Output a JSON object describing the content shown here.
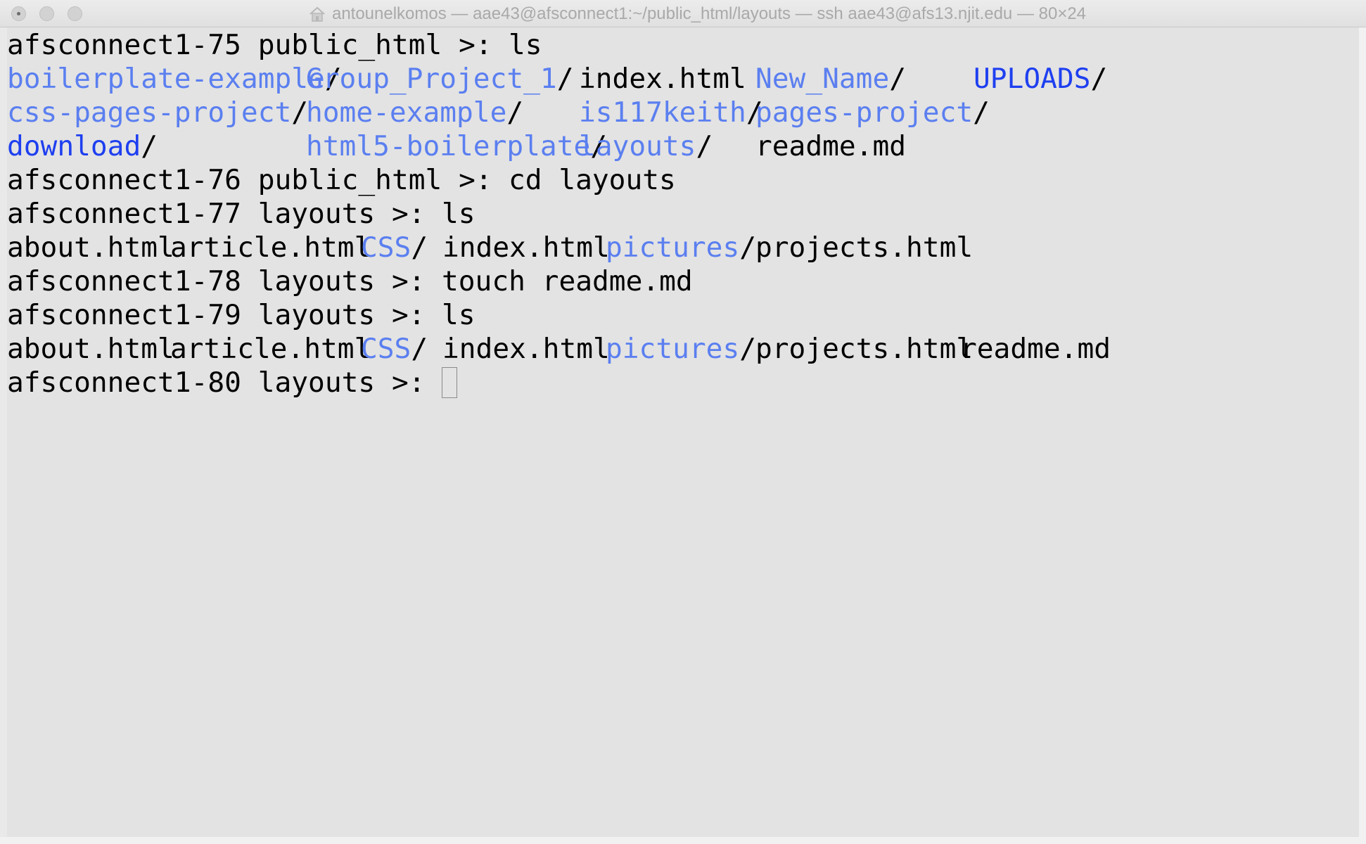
{
  "window": {
    "title": "antounelkomos — aae43@afsconnect1:~/public_html/layouts — ssh aae43@afs13.njit.edu — 80×24",
    "icon": "home-icon",
    "background": "#e3e3e3"
  },
  "colors": {
    "directory": "#5b7ff0",
    "directory_emphasized": "#1e3ff0",
    "text": "#000000"
  },
  "terminal": {
    "lines": [
      {
        "prompt": "afsconnect1-75 public_html >: ",
        "command": "ls"
      },
      {
        "entries": [
          {
            "name": "boilerplate-example",
            "suffix": "/",
            "type": "dir"
          },
          {
            "name": "Group_Project_1",
            "suffix": "/",
            "type": "dir"
          },
          {
            "name": "index.html",
            "suffix": "",
            "type": "file"
          },
          {
            "name": "New_Name",
            "suffix": "/",
            "type": "dir"
          },
          {
            "name": "UPLOADS",
            "suffix": "/",
            "type": "dir-strong"
          }
        ]
      },
      {
        "entries": [
          {
            "name": "css-pages-project",
            "suffix": "/",
            "type": "dir"
          },
          {
            "name": "home-example",
            "suffix": "/",
            "type": "dir"
          },
          {
            "name": "is117keith",
            "suffix": "/",
            "type": "dir"
          },
          {
            "name": "pages-project",
            "suffix": "/",
            "type": "dir"
          }
        ]
      },
      {
        "entries": [
          {
            "name": "download",
            "suffix": "/",
            "type": "dir-strong"
          },
          {
            "name": "html5-boilerplate",
            "suffix": "/",
            "type": "dir"
          },
          {
            "name": "layouts",
            "suffix": "/",
            "type": "dir"
          },
          {
            "name": "readme.md",
            "suffix": "",
            "type": "file"
          }
        ]
      },
      {
        "prompt": "afsconnect1-76 public_html >: ",
        "command": "cd layouts"
      },
      {
        "prompt": "afsconnect1-77 layouts >: ",
        "command": "ls"
      },
      {
        "entries": [
          {
            "name": "about.html",
            "suffix": "",
            "type": "file"
          },
          {
            "name": "article.html",
            "suffix": "",
            "type": "file"
          },
          {
            "name": "CSS",
            "suffix": "/",
            "type": "dir"
          },
          {
            "name": "index.html",
            "suffix": "",
            "type": "file"
          },
          {
            "name": "pictures",
            "suffix": "/",
            "type": "dir"
          },
          {
            "name": "projects.html",
            "suffix": "",
            "type": "file"
          }
        ]
      },
      {
        "prompt": "afsconnect1-78 layouts >: ",
        "command": "touch readme.md"
      },
      {
        "prompt": "afsconnect1-79 layouts >: ",
        "command": "ls"
      },
      {
        "entries": [
          {
            "name": "about.html",
            "suffix": "",
            "type": "file"
          },
          {
            "name": "article.html",
            "suffix": "",
            "type": "file"
          },
          {
            "name": "CSS",
            "suffix": "/",
            "type": "dir"
          },
          {
            "name": "index.html",
            "suffix": "",
            "type": "file"
          },
          {
            "name": "pictures",
            "suffix": "/",
            "type": "dir"
          },
          {
            "name": "projects.html",
            "suffix": "",
            "type": "file"
          },
          {
            "name": "readme.md",
            "suffix": "",
            "type": "file"
          }
        ]
      },
      {
        "prompt": "afsconnect1-80 layouts >: ",
        "command": "",
        "cursor": true
      }
    ]
  }
}
